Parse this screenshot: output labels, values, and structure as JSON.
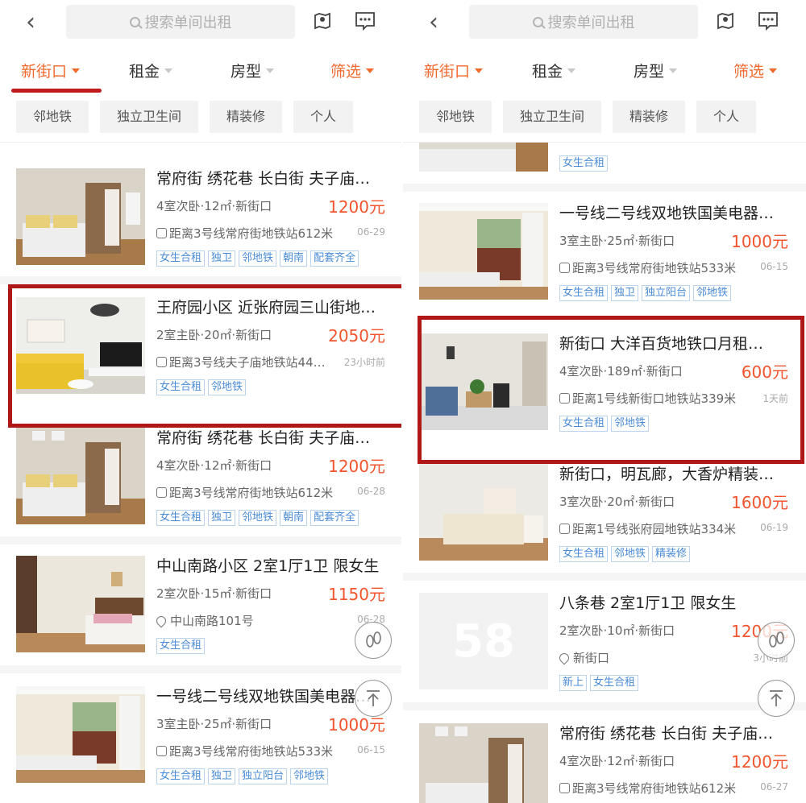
{
  "search": {
    "placeholder": "搜索单间出租"
  },
  "filters": {
    "location": "新街口",
    "rent": "租金",
    "room_type": "房型",
    "more": "筛选"
  },
  "chips": [
    "邻地铁",
    "独立卫生间",
    "精装修",
    "个人"
  ],
  "colors": {
    "accent": "#f26a2e",
    "price": "#f2542d",
    "tag": "#4a8bd6",
    "highlight": "#b01818"
  },
  "left_listings": [
    {
      "title": "常府街 绣花巷 长白街 夫子庙…",
      "meta": "4室次卧·12㎡·新街口",
      "price": "1200元",
      "loc": "距离3号线常府街地铁站612米",
      "time": "06-29",
      "tags": [
        "女生合租",
        "独卫",
        "邻地铁",
        "朝南",
        "配套齐全"
      ]
    },
    {
      "title": "王府园小区 近张府园三山街地…",
      "meta": "2室主卧·20㎡·新街口",
      "price": "2050元",
      "loc": "距离3号线夫子庙地铁站44…",
      "time": "23小时前",
      "tags": [
        "女生合租",
        "邻地铁"
      ]
    },
    {
      "title": "常府街 绣花巷 长白街 夫子庙…",
      "meta": "4室次卧·12㎡·新街口",
      "price": "1200元",
      "loc": "距离3号线常府街地铁站612米",
      "time": "06-28",
      "tags": [
        "女生合租",
        "独卫",
        "邻地铁",
        "朝南",
        "配套齐全"
      ]
    },
    {
      "title": "中山南路小区 2室1厅1卫 限女生",
      "meta": "2室次卧·15㎡·新街口",
      "price": "1150元",
      "loc": "中山南路101号",
      "time": "06-28",
      "tags": [
        "女生合租"
      ]
    },
    {
      "title": "一号线二号线双地铁国美电器…",
      "meta": "3室主卧·25㎡·新街口",
      "price": "1000元",
      "loc": "距离3号线常府街地铁站533米",
      "time": "06-15",
      "tags": [
        "女生合租",
        "独卫",
        "独立阳台",
        "邻地铁"
      ]
    }
  ],
  "right_listings": [
    {
      "title": "",
      "meta": "",
      "price": "",
      "loc": "",
      "time": "",
      "tags": [
        "女生合租"
      ]
    },
    {
      "title": "一号线二号线双地铁国美电器…",
      "meta": "3室主卧·25㎡·新街口",
      "price": "1000元",
      "loc": "距离3号线常府街地铁站533米",
      "time": "06-15",
      "tags": [
        "女生合租",
        "独卫",
        "独立阳台",
        "邻地铁"
      ]
    },
    {
      "title": "新街口  大洋百货地铁口月租…",
      "meta": "4室次卧·189㎡·新街口",
      "price": "600元",
      "loc": "距离1号线新街口地铁站339米",
      "time": "1天前",
      "tags": [
        "女生合租",
        "邻地铁"
      ]
    },
    {
      "title": "新街口，明瓦廊，大香炉精装…",
      "meta": "3室次卧·20㎡·新街口",
      "price": "1600元",
      "loc": "距离1号线张府园地铁站334米",
      "time": "06-19",
      "tags": [
        "女生合租",
        "邻地铁",
        "精装修"
      ]
    },
    {
      "title": "八条巷 2室1厅1卫 限女生",
      "meta": "2室次卧·10㎡·新街口",
      "price": "1200元",
      "loc": "新街口",
      "time": "3小时前",
      "tags": [
        "新上",
        "女生合租"
      ],
      "placeholder_logo": "58"
    },
    {
      "title": "常府街 绣花巷 长白街 夫子庙…",
      "meta": "4室次卧·12㎡·新街口",
      "price": "1200元",
      "loc": "距离3号线常府街地铁站612米",
      "time": "06-27",
      "tags": []
    }
  ]
}
